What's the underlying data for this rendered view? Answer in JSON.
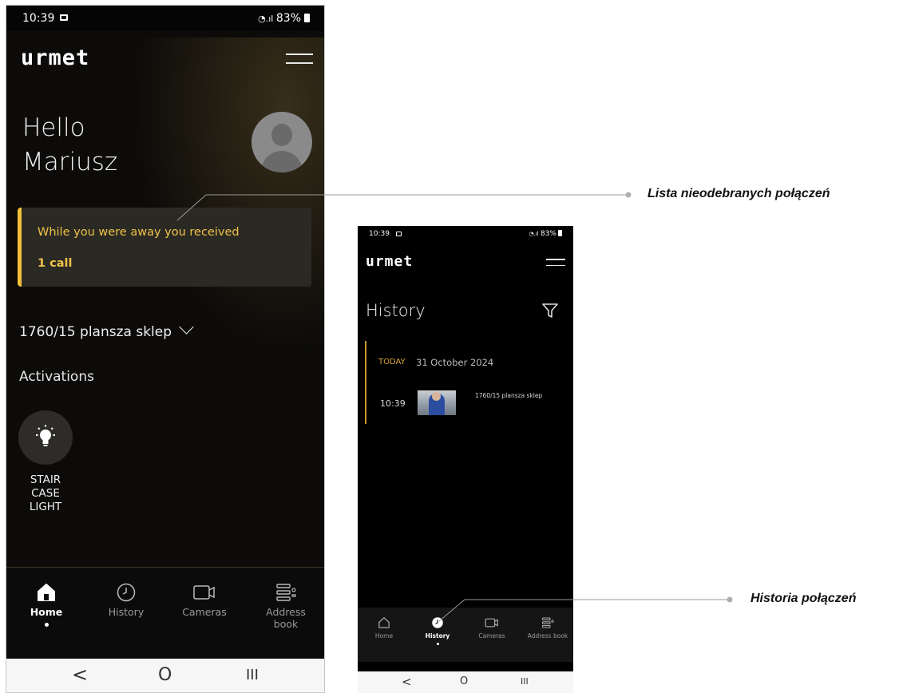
{
  "phone_home": {
    "status": {
      "time": "10:39",
      "battery": "83%"
    },
    "brand": "urmet",
    "greeting_line1": "Hello",
    "greeting_line2": "Mariusz",
    "missed": {
      "message": "While you were away you received",
      "count": "1 call"
    },
    "device": "1760/15 plansza sklep",
    "activations_title": "Activations",
    "activation": {
      "line1": "STAIR",
      "line2": "CASE",
      "line3": "LIGHT",
      "icon": "lightbulb-icon"
    },
    "nav": [
      {
        "label": "Home",
        "icon": "home-icon",
        "active": true
      },
      {
        "label": "History",
        "icon": "clock-icon",
        "active": false
      },
      {
        "label": "Cameras",
        "icon": "camera-icon",
        "active": false
      },
      {
        "label": "Address book",
        "icon": "address-book-icon",
        "active": false
      }
    ],
    "system_nav": {
      "back": "<",
      "home": "O",
      "recents": "III"
    }
  },
  "phone_history": {
    "status": {
      "time": "10:39",
      "battery": "83%"
    },
    "brand": "urmet",
    "title": "History",
    "day_tag": "TODAY",
    "date": "31 October 2024",
    "entries": [
      {
        "time": "10:39",
        "name": "1760/15 plansza sklep"
      }
    ],
    "nav": [
      {
        "label": "Home",
        "icon": "home-icon",
        "active": false
      },
      {
        "label": "History",
        "icon": "clock-icon",
        "active": true
      },
      {
        "label": "Cameras",
        "icon": "camera-icon",
        "active": false
      },
      {
        "label": "Address book",
        "icon": "address-book-icon",
        "active": false
      }
    ],
    "system_nav": {
      "back": "<",
      "home": "O",
      "recents": "III"
    }
  },
  "callouts": {
    "missed_calls": "Lista nieodebranych połączeń",
    "history": "Historia połączeń"
  },
  "colors": {
    "accent": "#f3c13a",
    "background": "#000000",
    "card": "#2b2923"
  }
}
